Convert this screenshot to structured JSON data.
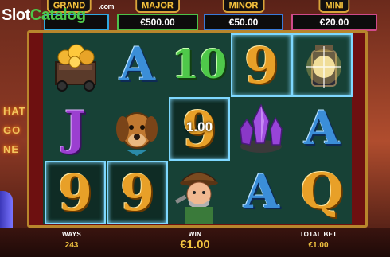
{
  "watermark": {
    "part1": "Slot",
    "part2": "Catalog",
    "suffix": ".com"
  },
  "side_sign": {
    "line1": "HAT",
    "line2": "GO",
    "line3": "NE"
  },
  "jackpots": [
    {
      "name": "GRAND",
      "value": ""
    },
    {
      "name": "MAJOR",
      "value": "€500.00"
    },
    {
      "name": "MINOR",
      "value": "€50.00"
    },
    {
      "name": "MINI",
      "value": "€20.00"
    }
  ],
  "reels": {
    "win_overlay_amount": "1.00",
    "grid": [
      [
        "gold-cart",
        "A",
        "10",
        "9",
        "lantern"
      ],
      [
        "J",
        "hound-dog",
        "9",
        "purple-crystals",
        "A"
      ],
      [
        "9",
        "9",
        "miner",
        "A",
        "Q"
      ]
    ],
    "winning_cells": [
      "r0c3",
      "r0c4",
      "r1c2",
      "r2c0",
      "r2c1"
    ],
    "colors": {
      "A": "#3b8ed8",
      "J": "#9b3fd0",
      "9": "#e8a028",
      "10": "#4fc84a",
      "Q": "#e8a028"
    }
  },
  "bottom": {
    "ways_label": "WAYS",
    "ways_value": "243",
    "win_label": "WIN",
    "win_value": "€1.00",
    "bet_label": "TOTAL BET",
    "bet_value": "€1.00"
  }
}
